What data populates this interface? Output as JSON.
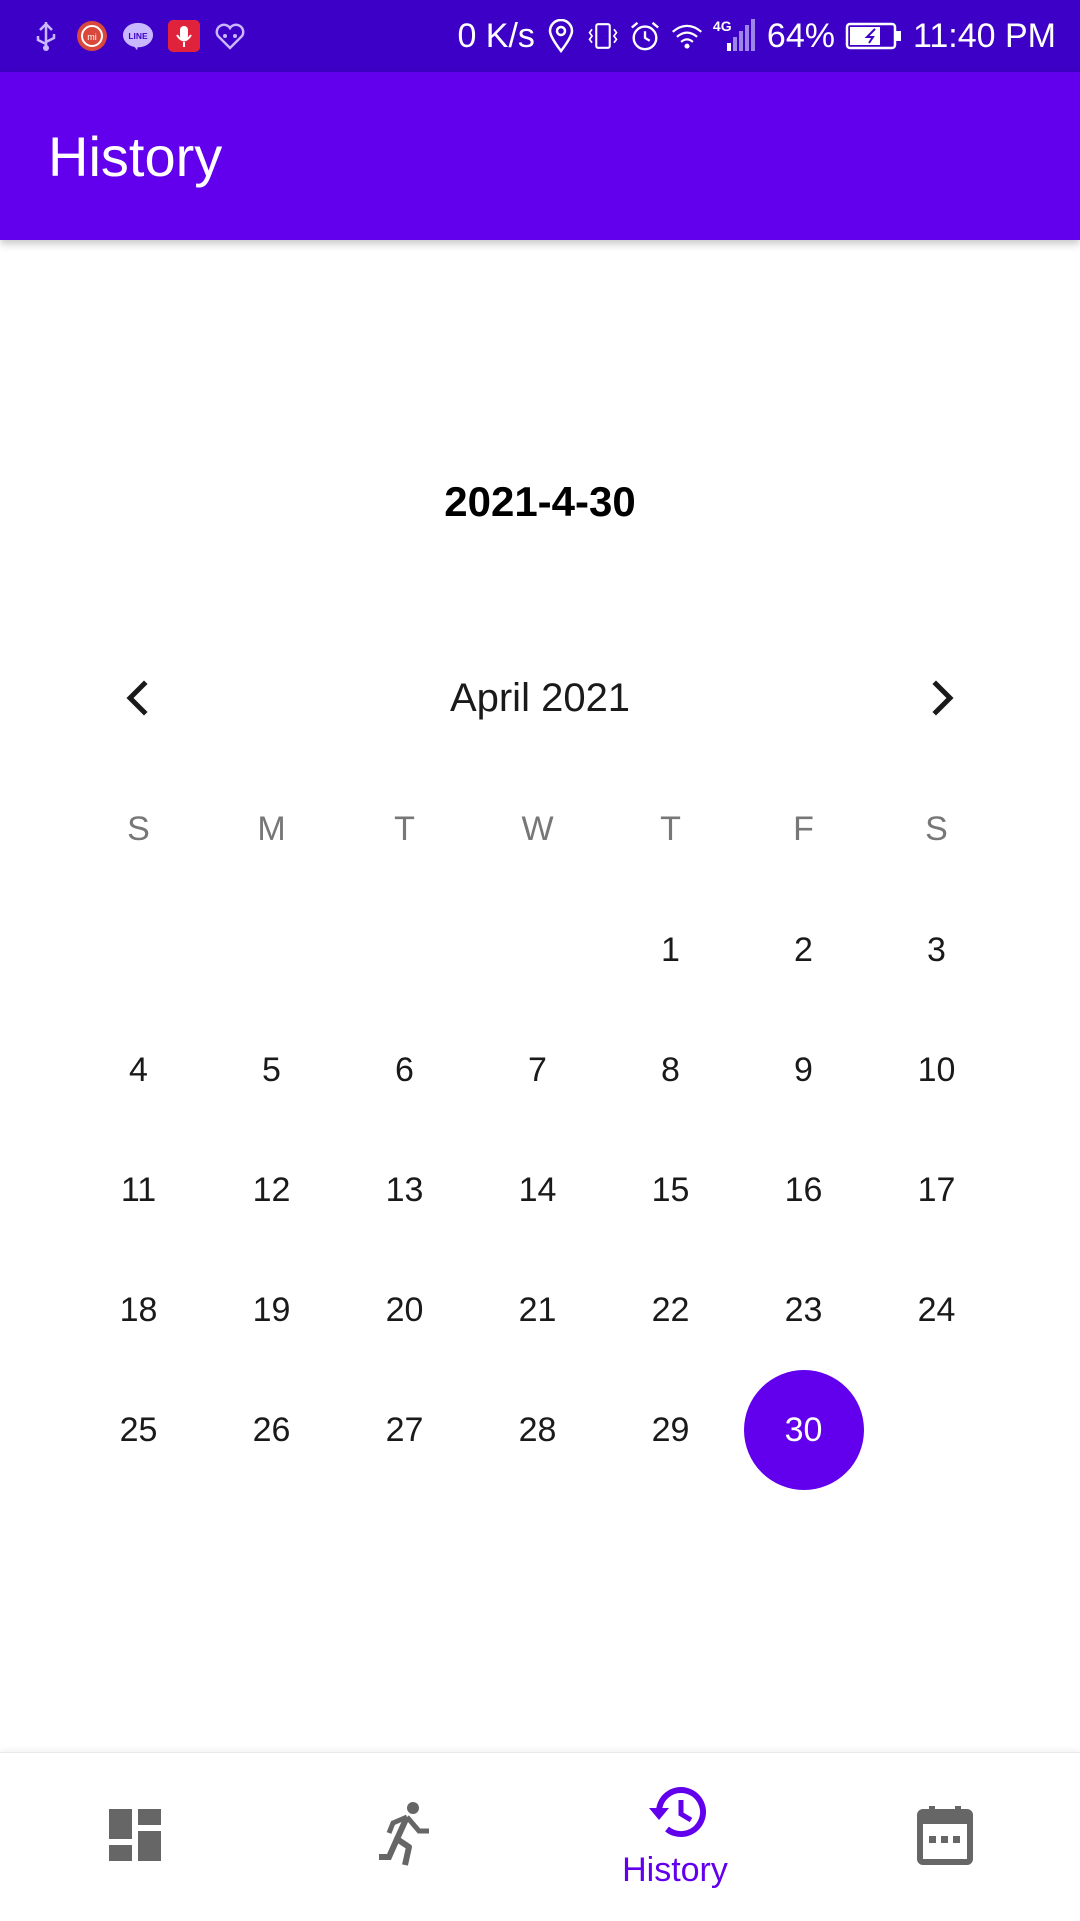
{
  "status_bar": {
    "net_speed": "0 K/s",
    "network": "4G",
    "battery": "64%",
    "time": "11:40 PM",
    "left_icons": [
      "usb-icon",
      "mi-icon",
      "line-icon",
      "mic-icon",
      "health-icon"
    ],
    "background": "#3d00c6"
  },
  "app_bar": {
    "title": "History",
    "background": "#6200ee"
  },
  "selected_date_text": "2021-4-30",
  "calendar": {
    "month_label": "April 2021",
    "weekdays": [
      "S",
      "M",
      "T",
      "W",
      "T",
      "F",
      "S"
    ],
    "first_weekday_index": 4,
    "days": [
      "1",
      "2",
      "3",
      "4",
      "5",
      "6",
      "7",
      "8",
      "9",
      "10",
      "11",
      "12",
      "13",
      "14",
      "15",
      "16",
      "17",
      "18",
      "19",
      "20",
      "21",
      "22",
      "23",
      "24",
      "25",
      "26",
      "27",
      "28",
      "29",
      "30"
    ],
    "selected_day": "30",
    "accent": "#6200ee"
  },
  "bottom_nav": {
    "items": [
      {
        "icon": "dashboard-icon",
        "label": "",
        "active": false
      },
      {
        "icon": "run-icon",
        "label": "",
        "active": false
      },
      {
        "icon": "history-icon",
        "label": "History",
        "active": true
      },
      {
        "icon": "calendar-icon",
        "label": "",
        "active": false
      }
    ],
    "active_color": "#6200ee",
    "inactive_color": "#666666"
  }
}
